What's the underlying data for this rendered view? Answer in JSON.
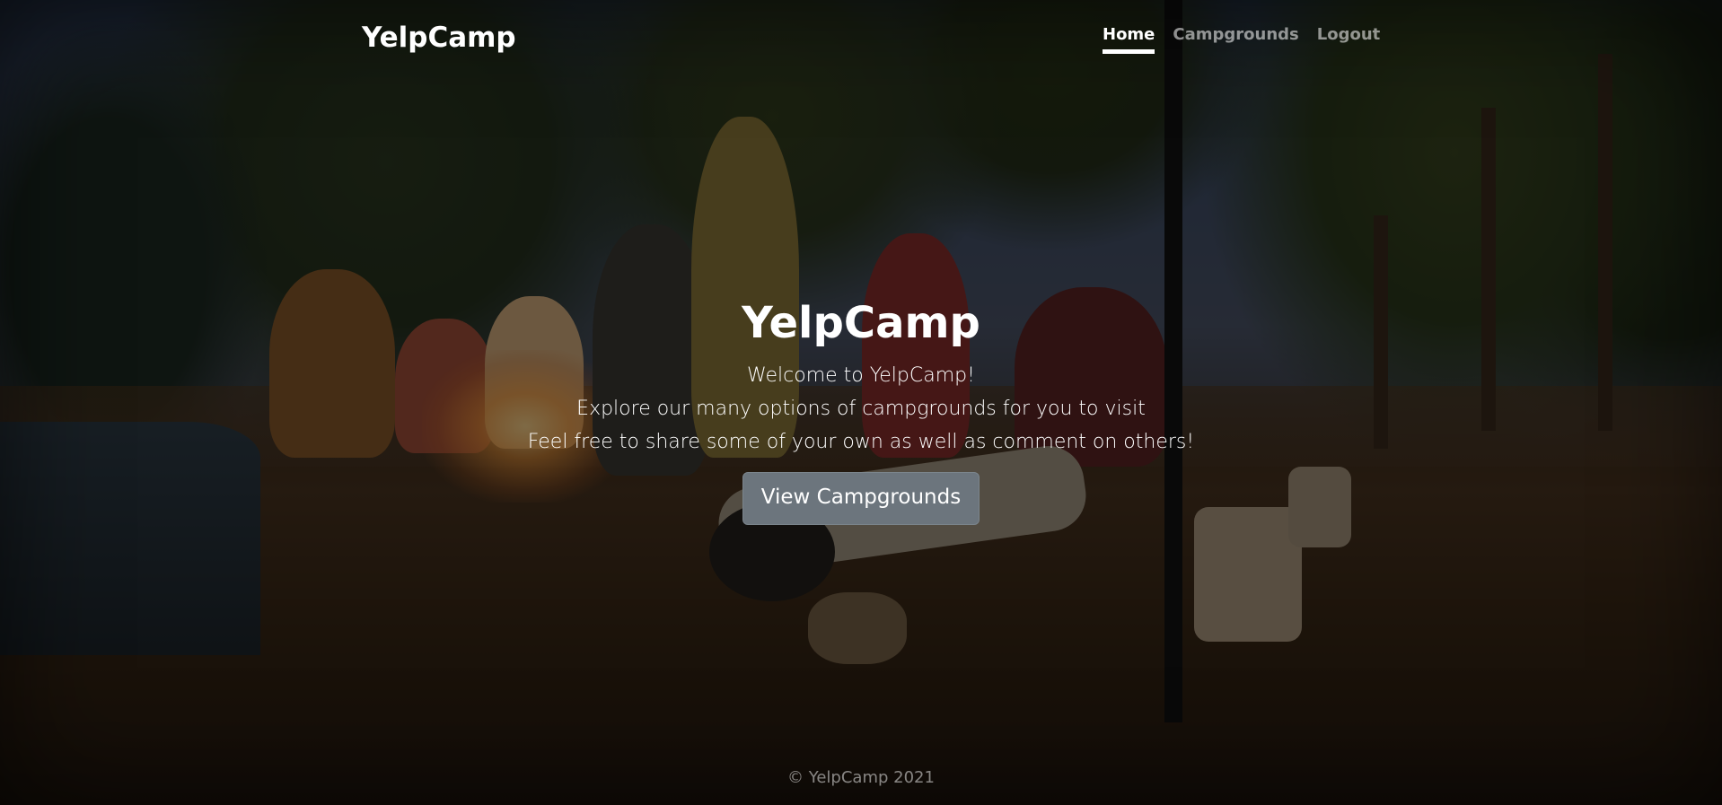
{
  "navbar": {
    "brand": "YelpCamp",
    "links": [
      {
        "label": "Home",
        "active": true
      },
      {
        "label": "Campgrounds",
        "active": false
      },
      {
        "label": "Logout",
        "active": false
      }
    ]
  },
  "hero": {
    "title": "YelpCamp",
    "lines": [
      "Welcome to YelpCamp!",
      "Explore our many options of campgrounds for you to visit",
      "Feel free to share some of your own as well as comment on others!"
    ],
    "button_label": "View Campgrounds"
  },
  "footer": {
    "text": "© YelpCamp 2021"
  },
  "colors": {
    "button_bg": "#6c757d",
    "text_primary": "#ffffff",
    "nav_inactive": "rgba(255,255,255,0.55)",
    "overlay": "rgba(0,0,0,0.5)"
  }
}
